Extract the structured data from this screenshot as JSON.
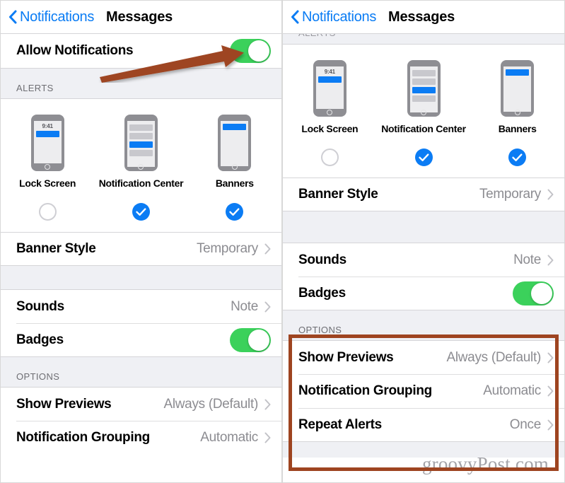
{
  "nav": {
    "back_label": "Notifications",
    "title": "Messages",
    "back_icon": "chevron-left-icon",
    "accent_color": "#0a7cf4"
  },
  "left_panel": {
    "allow_notifications": {
      "label": "Allow Notifications",
      "toggle_state": "on",
      "toggle_color": "#3bd15b"
    },
    "alerts_header": "ALERTS",
    "alert_styles": [
      {
        "caption": "Lock Screen",
        "icon": "phone-lock-screen-icon",
        "selected": false,
        "clock": "9:41"
      },
      {
        "caption": "Notification Center",
        "icon": "phone-notification-center-icon",
        "selected": true
      },
      {
        "caption": "Banners",
        "icon": "phone-banner-icon",
        "selected": true
      }
    ],
    "rows": [
      {
        "label": "Banner Style",
        "value": "Temporary",
        "type": "disclosure"
      },
      {
        "label": "Sounds",
        "value": "Note",
        "type": "disclosure"
      },
      {
        "label": "Badges",
        "value": "",
        "type": "toggle",
        "toggle_state": "on"
      }
    ],
    "options_header": "OPTIONS",
    "option_rows": [
      {
        "label": "Show Previews",
        "value": "Always (Default)",
        "type": "disclosure"
      },
      {
        "label": "Notification Grouping",
        "value": "Automatic",
        "type": "disclosure"
      }
    ],
    "annotation": {
      "type": "arrow",
      "points_to": "allow-notifications-toggle",
      "color": "#9e4420"
    }
  },
  "right_panel": {
    "alerts_header_clipped": "ALERTS",
    "alert_styles": [
      {
        "caption": "Lock Screen",
        "icon": "phone-lock-screen-icon",
        "selected": false,
        "clock": "9:41"
      },
      {
        "caption": "Notification Center",
        "icon": "phone-notification-center-icon",
        "selected": true
      },
      {
        "caption": "Banners",
        "icon": "phone-banner-icon",
        "selected": true
      }
    ],
    "rows": [
      {
        "label": "Banner Style",
        "value": "Temporary",
        "type": "disclosure"
      },
      {
        "label": "Sounds",
        "value": "Note",
        "type": "disclosure"
      },
      {
        "label": "Badges",
        "value": "",
        "type": "toggle",
        "toggle_state": "on"
      }
    ],
    "options_header": "OPTIONS",
    "option_rows": [
      {
        "label": "Show Previews",
        "value": "Always (Default)",
        "type": "disclosure"
      },
      {
        "label": "Notification Grouping",
        "value": "Automatic",
        "type": "disclosure"
      },
      {
        "label": "Repeat Alerts",
        "value": "Once",
        "type": "disclosure"
      }
    ],
    "highlight": {
      "target": "options-section",
      "color": "#9e4420"
    }
  },
  "watermark": "groovyPost.com"
}
